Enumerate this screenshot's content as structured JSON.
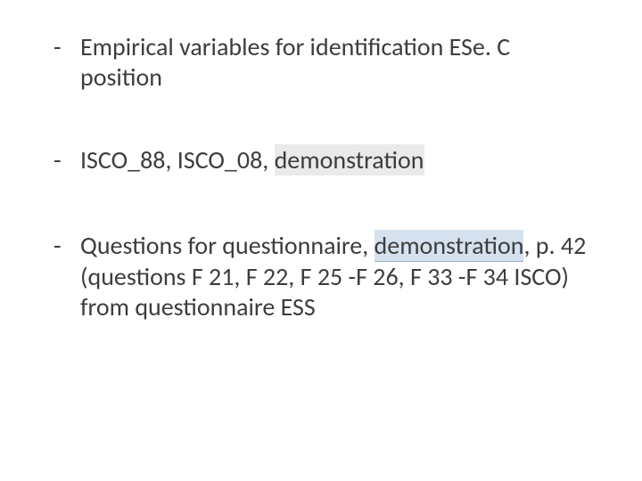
{
  "bullets": {
    "b1": {
      "dash": "-",
      "text": "Empirical variables for identification ESe. C position"
    },
    "b2": {
      "dash": "-",
      "prefix": "ISCO_88, ISCO_08, ",
      "hl": "demonstration"
    },
    "b3": {
      "dash": "-",
      "prefix": "Questions for questionnaire, ",
      "hl": "demonstration",
      "suffix": ", p. 42 (questions F 21, F 22, F 25 -F 26, F 33 -F 34 ISCO) from questionnaire ESS"
    }
  }
}
